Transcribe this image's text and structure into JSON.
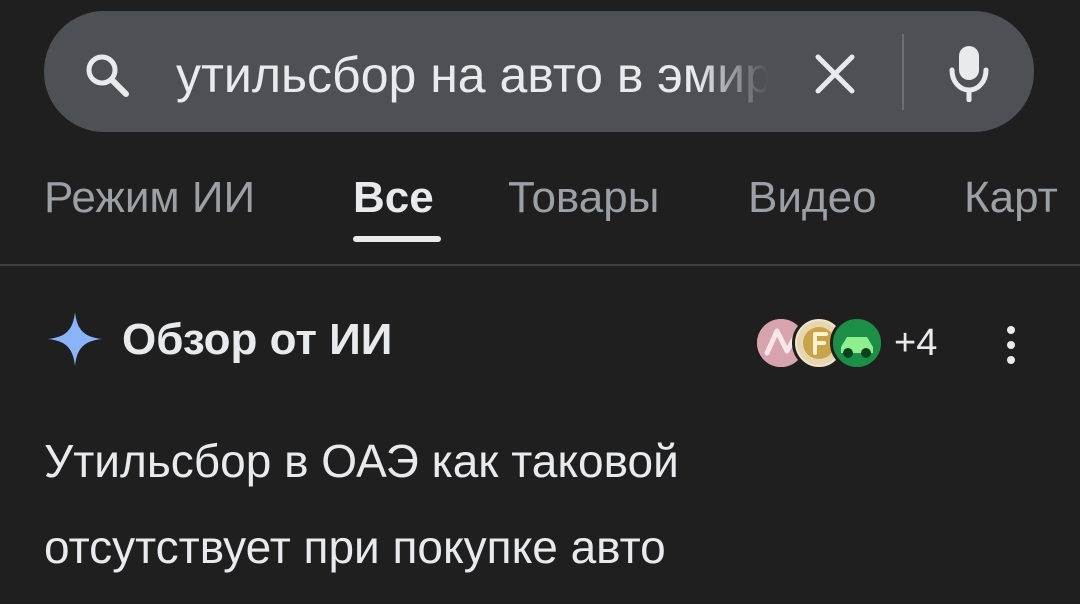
{
  "search": {
    "query": "утильсбор на авто в эмиратах",
    "icons": {
      "search": "search-icon",
      "clear": "close-icon",
      "voice": "microphone-icon"
    }
  },
  "tabs": [
    {
      "label": "Режим ИИ",
      "active": false
    },
    {
      "label": "Все",
      "active": true
    },
    {
      "label": "Товары",
      "active": false
    },
    {
      "label": "Видео",
      "active": false
    },
    {
      "label": "Карт",
      "active": false
    }
  ],
  "ai_overview": {
    "title": "Обзор от ИИ",
    "icon": "sparkle-icon",
    "sources_more": "+4",
    "menu_icon": "kebab-menu-icon",
    "answer_lines": [
      "Утильсбор в ОАЭ как таковой",
      "отсутствует при покупке авто"
    ]
  },
  "colors": {
    "background": "#1f1f1f",
    "search_bar": "#4d5156",
    "text_primary": "#e8eaed",
    "text_secondary": "#9aa0a6",
    "divider": "#3c4043",
    "accent_blue": "#8ab4f8"
  }
}
